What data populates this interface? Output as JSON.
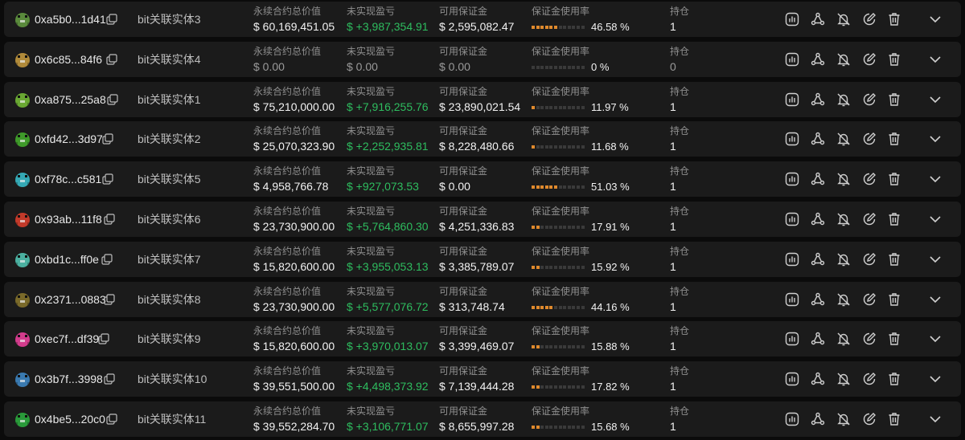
{
  "labels": {
    "contract_value": "永续合约总价值",
    "unrealized_pnl": "未实现盈亏",
    "available_margin": "可用保证金",
    "margin_ratio": "保证金使用率",
    "positions": "持仓"
  },
  "icons": [
    "chart-icon",
    "network-icon",
    "bell-off-icon",
    "edit-icon",
    "trash-icon",
    "chevron-down-icon"
  ],
  "colors": {
    "positive": "#2ebd5f",
    "bar_fill": "#e08a2d",
    "bar_empty": "#3a3a3a"
  },
  "rows": [
    {
      "address": "0xa5b0...1d41",
      "entity": "bit关联实体3",
      "contract_value": "$ 60,169,451.05",
      "pnl": "$ +3,987,354.91",
      "pnl_state": "pos",
      "margin": "$ 2,595,082.47",
      "ratio": 46.58,
      "ratio_text": "46.58 %",
      "positions": "1",
      "avatar": "#5a8a3c"
    },
    {
      "address": "0x6c85...84f6",
      "entity": "bit关联实体4",
      "contract_value": "$ 0.00",
      "pnl": "$ 0.00",
      "pnl_state": "zero",
      "margin": "$ 0.00",
      "ratio": 0,
      "ratio_text": "0 %",
      "positions": "0",
      "avatar": "#b08a3a"
    },
    {
      "address": "0xa875...25a8",
      "entity": "bit关联实体1",
      "contract_value": "$ 75,210,000.00",
      "pnl": "$ +7,916,255.76",
      "pnl_state": "pos",
      "margin": "$ 23,890,021.54",
      "ratio": 11.97,
      "ratio_text": "11.97 %",
      "positions": "1",
      "avatar": "#6aa833"
    },
    {
      "address": "0xfd42...3d97",
      "entity": "bit关联实体2",
      "contract_value": "$ 25,070,323.90",
      "pnl": "$ +2,252,935.81",
      "pnl_state": "pos",
      "margin": "$ 8,228,480.66",
      "ratio": 11.68,
      "ratio_text": "11.68 %",
      "positions": "1",
      "avatar": "#3f9a2a"
    },
    {
      "address": "0xf78c...c581",
      "entity": "bit关联实体5",
      "contract_value": "$ 4,958,766.78",
      "pnl": "$ +927,073.53",
      "pnl_state": "pos",
      "margin": "$ 0.00",
      "ratio": 51.03,
      "ratio_text": "51.03 %",
      "positions": "1",
      "avatar": "#35a9b5"
    },
    {
      "address": "0x93ab...11f8",
      "entity": "bit关联实体6",
      "contract_value": "$ 23,730,900.00",
      "pnl": "$ +5,764,860.30",
      "pnl_state": "pos",
      "margin": "$ 4,251,336.83",
      "ratio": 17.91,
      "ratio_text": "17.91 %",
      "positions": "1",
      "avatar": "#c23a2a"
    },
    {
      "address": "0xbd1c...ff0e",
      "entity": "bit关联实体7",
      "contract_value": "$ 15,820,600.00",
      "pnl": "$ +3,955,053.13",
      "pnl_state": "pos",
      "margin": "$ 3,385,789.07",
      "ratio": 15.92,
      "ratio_text": "15.92 %",
      "positions": "1",
      "avatar": "#4bb0a0"
    },
    {
      "address": "0x2371...0883",
      "entity": "bit关联实体8",
      "contract_value": "$ 23,730,900.00",
      "pnl": "$ +5,577,076.72",
      "pnl_state": "pos",
      "margin": "$ 313,748.74",
      "ratio": 44.16,
      "ratio_text": "44.16 %",
      "positions": "1",
      "avatar": "#7a6a2a"
    },
    {
      "address": "0xec7f...df39",
      "entity": "bit关联实体9",
      "contract_value": "$ 15,820,600.00",
      "pnl": "$ +3,970,013.07",
      "pnl_state": "pos",
      "margin": "$ 3,399,469.07",
      "ratio": 15.88,
      "ratio_text": "15.88 %",
      "positions": "1",
      "avatar": "#d23c8c"
    },
    {
      "address": "0x3b7f...3998",
      "entity": "bit关联实体10",
      "contract_value": "$ 39,551,500.00",
      "pnl": "$ +4,498,373.92",
      "pnl_state": "pos",
      "margin": "$ 7,139,444.28",
      "ratio": 17.82,
      "ratio_text": "17.82 %",
      "positions": "1",
      "avatar": "#3a7ab0"
    },
    {
      "address": "0x4be5...20c0",
      "entity": "bit关联实体11",
      "contract_value": "$ 39,552,284.70",
      "pnl": "$ +3,106,771.07",
      "pnl_state": "pos",
      "margin": "$ 8,655,997.28",
      "ratio": 15.68,
      "ratio_text": "15.68 %",
      "positions": "1",
      "avatar": "#2a9a3a"
    }
  ]
}
